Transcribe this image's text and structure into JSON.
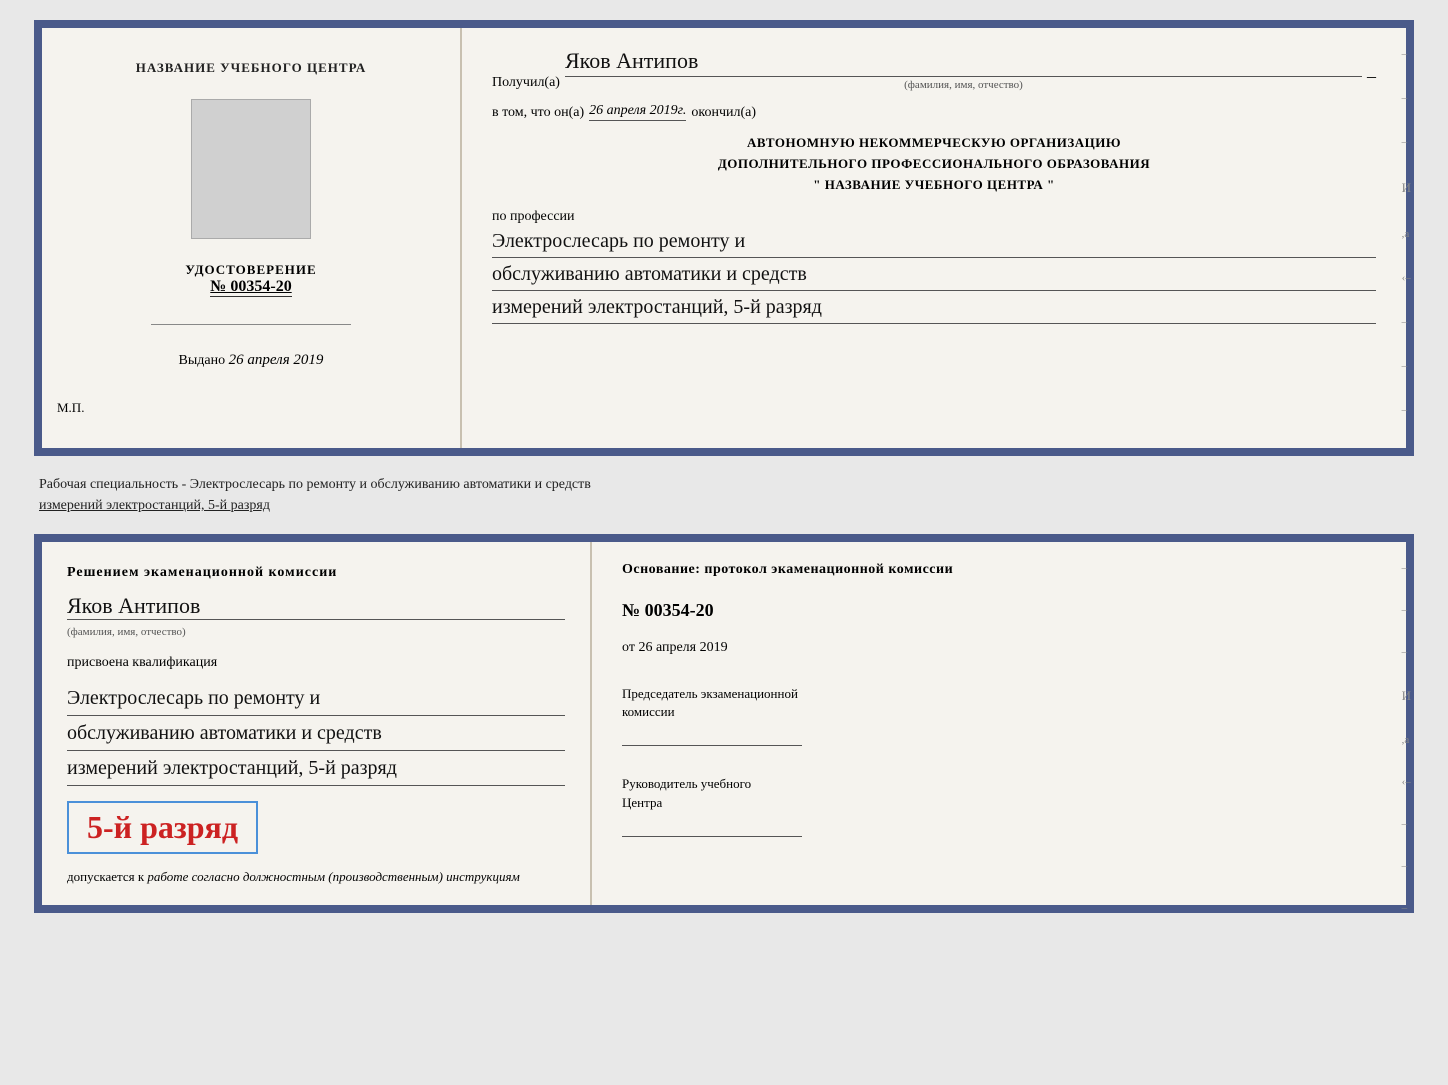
{
  "top_doc": {
    "left": {
      "title_line1": "НАЗВАНИЕ УЧЕБНОГО ЦЕНТРА",
      "cert_label": "УДОСТОВЕРЕНИЕ",
      "cert_number": "№ 00354-20",
      "issued_label": "Выдано",
      "issued_date": "26 апреля 2019",
      "mp_label": "М.П."
    },
    "right": {
      "received_label": "Получил(а)",
      "recipient_name": "Яков Антипов",
      "recipient_sub": "(фамилия, имя, отчество)",
      "date_prefix": "в том, что он(а)",
      "date_value": "26 апреля 2019г.",
      "date_suffix": "окончил(а)",
      "org_line1": "АВТОНОМНУЮ НЕКОММЕРЧЕСКУЮ ОРГАНИЗАЦИЮ",
      "org_line2": "ДОПОЛНИТЕЛЬНОГО ПРОФЕССИОНАЛЬНОГО ОБРАЗОВАНИЯ",
      "org_line3": "\" НАЗВАНИЕ УЧЕБНОГО ЦЕНТРА \"",
      "profession_label": "по профессии",
      "profession_line1": "Электрослесарь по ремонту и",
      "profession_line2": "обслуживанию автоматики и средств",
      "profession_line3": "измерений электростанций, 5-й разряд"
    }
  },
  "middle_text": {
    "line1": "Рабочая специальность - Электрослесарь по ремонту и обслуживанию автоматики и средств",
    "line2": "измерений электростанций, 5-й разряд"
  },
  "bottom_doc": {
    "left": {
      "commission_title": "Решением экаменационной комиссии",
      "person_name": "Яков Антипов",
      "person_sub": "(фамилия, имя, отчество)",
      "assigned_label": "присвоена квалификация",
      "qual_line1": "Электрослесарь по ремонту и",
      "qual_line2": "обслуживанию автоматики и средств",
      "qual_line3": "измерений электростанций, 5-й разряд",
      "rank_text": "5-й разряд",
      "allowed_prefix": "допускается к",
      "allowed_italic": "работе согласно должностным (производственным) инструкциям"
    },
    "right": {
      "basis_label": "Основание: протокол экаменационной комиссии",
      "protocol_number": "№ 00354-20",
      "date_prefix": "от",
      "date_value": "26 апреля 2019",
      "chairman_title": "Председатель экзаменационной",
      "chairman_title2": "комиссии",
      "director_title": "Руководитель учебного",
      "director_title2": "Центра"
    }
  }
}
